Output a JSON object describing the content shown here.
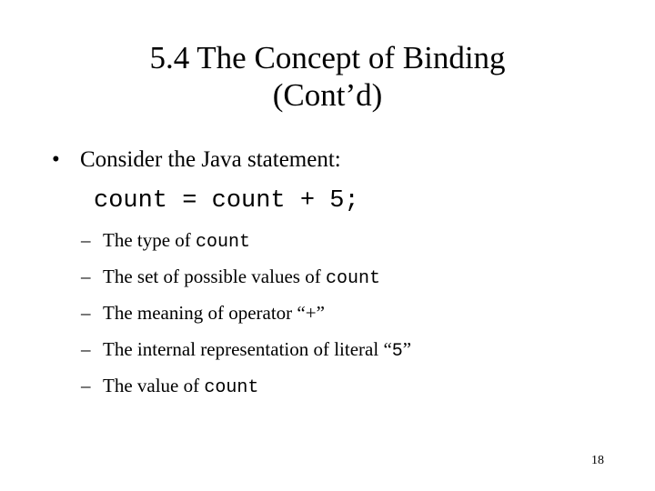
{
  "slide": {
    "title_lines": [
      "5.4 The Concept of Binding",
      "(Cont’d)"
    ],
    "bullets": [
      {
        "marker": "•",
        "text": "Consider the Java statement:"
      }
    ],
    "code_line": "count = count + 5;",
    "sub_bullets": [
      {
        "marker": "–",
        "prefix": "The type of ",
        "code": "count",
        "suffix": ""
      },
      {
        "marker": "–",
        "prefix": "The set of possible values of ",
        "code": "count",
        "suffix": ""
      },
      {
        "marker": "–",
        "prefix": "The meaning of operator “",
        "code": "+",
        "suffix": "”"
      },
      {
        "marker": "–",
        "prefix": "The internal representation of literal “",
        "code": "5",
        "suffix": "”"
      },
      {
        "marker": "–",
        "prefix": "The value of ",
        "code": "count",
        "suffix": ""
      }
    ],
    "page_number": "18",
    "colors": {
      "background": "#ffffff",
      "text": "#000000"
    }
  }
}
